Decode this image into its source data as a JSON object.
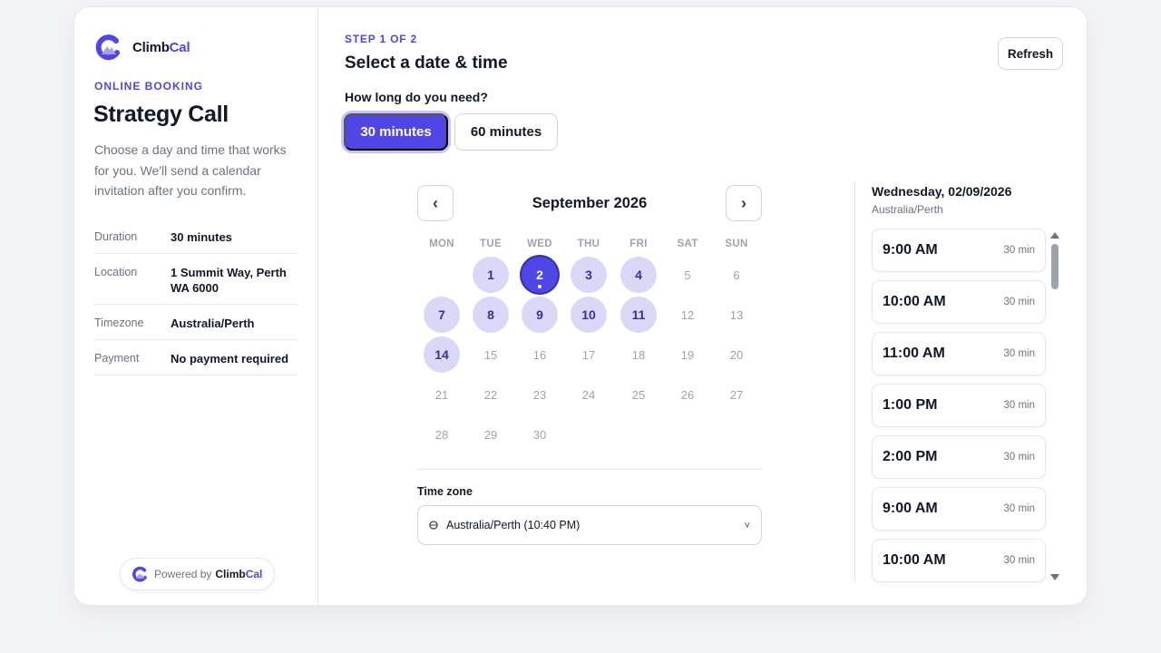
{
  "brand": {
    "name_part1": "Climb",
    "name_part2": "Cal",
    "accent_color": "#4f46e5"
  },
  "summary": {
    "eyebrow": "ONLINE BOOKING",
    "title": "Strategy Call",
    "description": "Choose a day and time that works for you. We'll send a calendar invitation after you confirm.",
    "details": [
      {
        "label": "Duration",
        "value": "30 minutes"
      },
      {
        "label": "Location",
        "value": "1 Summit Way, Perth WA 6000"
      },
      {
        "label": "Timezone",
        "value": "Australia/Perth"
      },
      {
        "label": "Payment",
        "value": "No payment required"
      }
    ],
    "powered_by_prefix": "Powered by",
    "powered_by_brand_part1": "Climb",
    "powered_by_brand_part2": "Cal"
  },
  "header": {
    "step": "STEP 1 OF 2",
    "title": "Select a date & time",
    "refresh_label": "Refresh"
  },
  "duration": {
    "question": "How long do you need?",
    "options": [
      {
        "label": "30 minutes",
        "selected": true
      },
      {
        "label": "60 minutes",
        "selected": false
      }
    ]
  },
  "calendar": {
    "month_label": "September 2026",
    "prev_label": "‹",
    "next_label": "›",
    "weekdays": [
      "MON",
      "TUE",
      "WED",
      "THU",
      "FRI",
      "SAT",
      "SUN"
    ],
    "first_weekday_index": 1,
    "days_in_month": 30,
    "available_days": [
      1,
      2,
      3,
      4,
      7,
      8,
      9,
      10,
      11,
      14
    ],
    "selected_day": 2
  },
  "timezone": {
    "label": "Time zone",
    "value": "Australia/Perth (10:40 PM)",
    "chevron": "˅"
  },
  "slots": {
    "date_label": "Wednesday, 02/09/2026",
    "timezone": "Australia/Perth",
    "items": [
      {
        "time": "9:00 AM",
        "duration": "30 min"
      },
      {
        "time": "10:00 AM",
        "duration": "30 min"
      },
      {
        "time": "11:00 AM",
        "duration": "30 min"
      },
      {
        "time": "1:00 PM",
        "duration": "30 min"
      },
      {
        "time": "2:00 PM",
        "duration": "30 min"
      },
      {
        "time": "9:00 AM",
        "duration": "30 min"
      },
      {
        "time": "10:00 AM",
        "duration": "30 min"
      }
    ]
  }
}
